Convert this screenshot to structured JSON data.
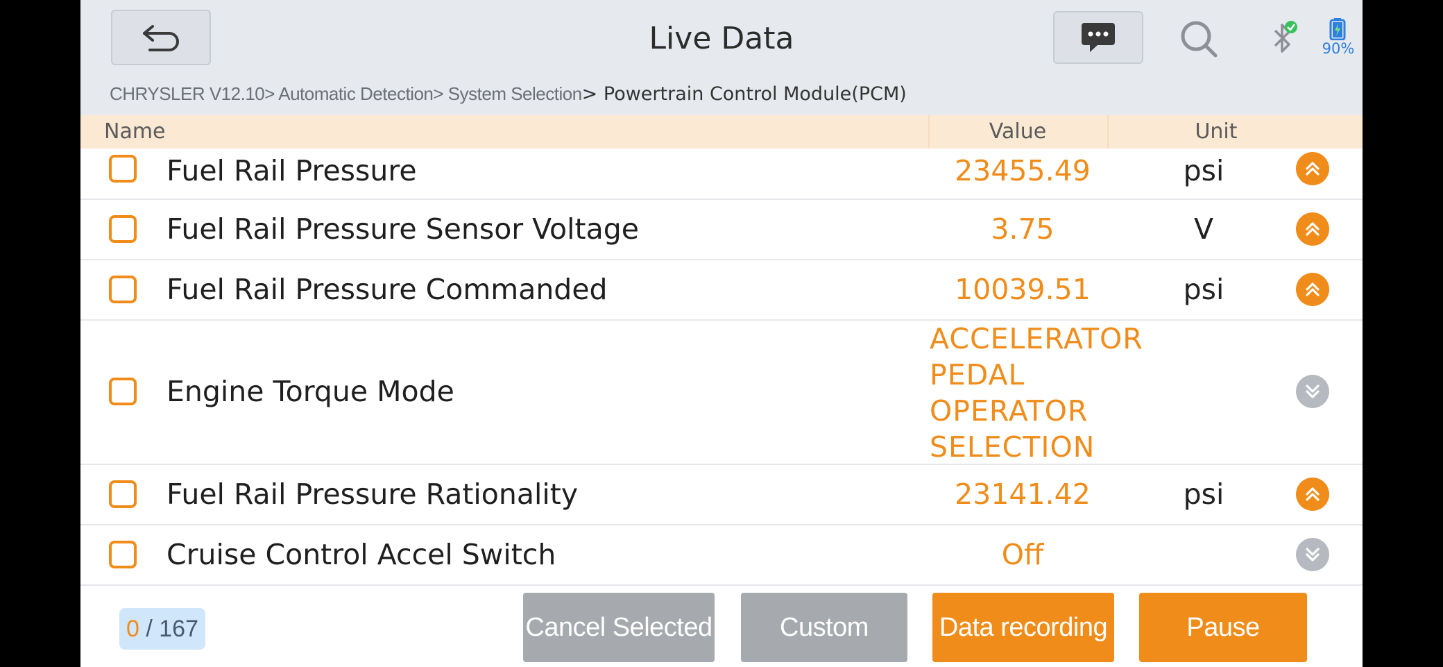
{
  "header": {
    "title": "Live Data",
    "battery": "90%"
  },
  "breadcrumb": {
    "path": "CHRYSLER V12.10> Automatic Detection> System Selection",
    "current": "> Powertrain Control Module(PCM)"
  },
  "columns": {
    "name": "Name",
    "value": "Value",
    "unit": "Unit"
  },
  "rows": [
    {
      "name": "Fuel Rail Pressure",
      "value": "23455.49",
      "unit": "psi",
      "toggle": "up"
    },
    {
      "name": "Fuel Rail Pressure Sensor Voltage",
      "value": "3.75",
      "unit": "V",
      "toggle": "up"
    },
    {
      "name": "Fuel Rail Pressure Commanded",
      "value": "10039.51",
      "unit": "psi",
      "toggle": "up"
    },
    {
      "name": "Engine Torque Mode",
      "value": "ACCELERATOR PEDAL OPERATOR SELECTION",
      "unit": "",
      "toggle": "down"
    },
    {
      "name": "Fuel Rail Pressure Rationality",
      "value": "23141.42",
      "unit": "psi",
      "toggle": "up"
    },
    {
      "name": "Cruise Control Accel Switch",
      "value": "Off",
      "unit": "",
      "toggle": "down"
    }
  ],
  "footer": {
    "selected": "0",
    "separator": " / ",
    "total": "167",
    "cancel_label": "Cancel Selected",
    "custom_label": "Custom",
    "record_label": "Data recording",
    "pause_label": "Pause"
  },
  "colors": {
    "accent": "#f08c1a",
    "header_bg": "#e6e9ee",
    "column_header_bg": "#fbe9d4",
    "button_gray": "#a6a9ae"
  }
}
